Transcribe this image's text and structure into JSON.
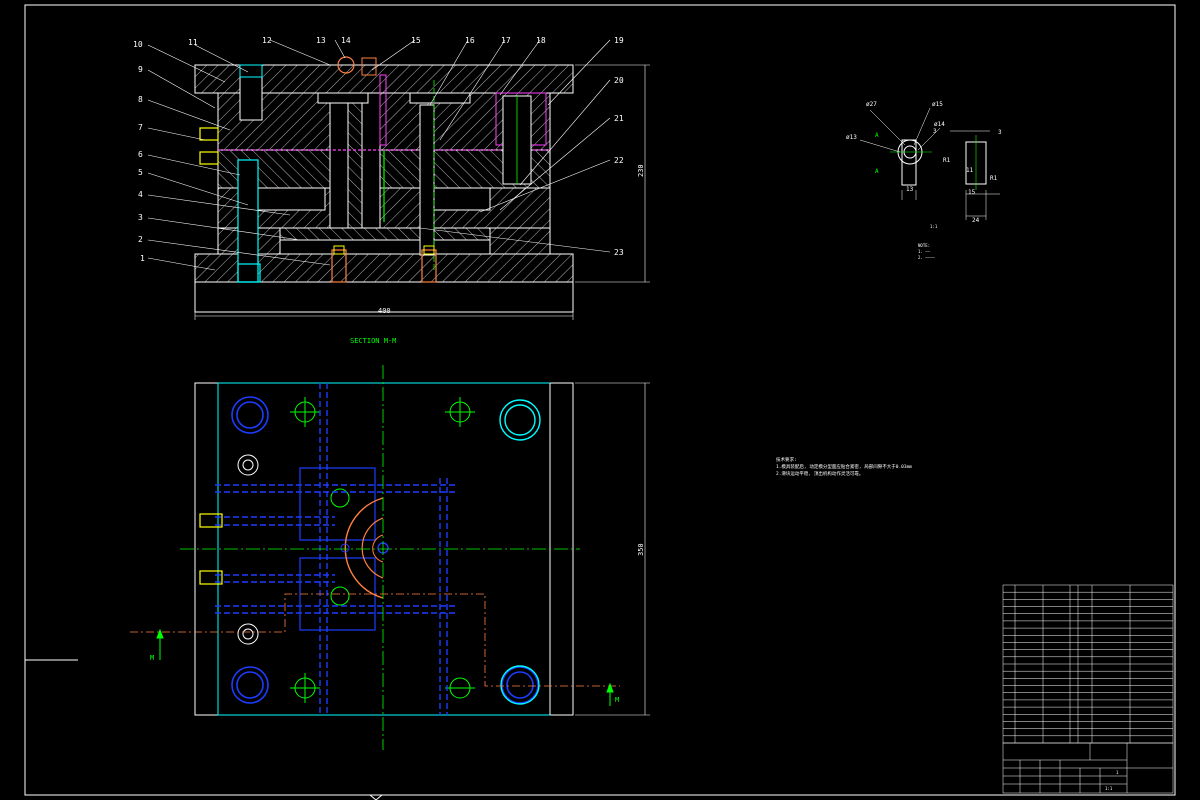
{
  "drawing": {
    "section_title": "SECTION M-M",
    "section_mark": "M",
    "balloons": [
      "1",
      "2",
      "3",
      "4",
      "5",
      "6",
      "7",
      "8",
      "9",
      "10",
      "11",
      "12",
      "13",
      "14",
      "15",
      "16",
      "17",
      "18",
      "19",
      "20",
      "21",
      "22",
      "23"
    ],
    "dims": {
      "width_top": "400",
      "height_side": "230",
      "height_plan": "350"
    },
    "detail": {
      "labels": [
        "ø27",
        "ø15",
        "ø13",
        "ø14",
        "A",
        "A",
        "3",
        "R1",
        "R1",
        "13",
        "15",
        "3",
        "11",
        "24"
      ],
      "caption": "1:1",
      "notes": [
        "NOTE:",
        "1. ——",
        "2. ————"
      ]
    },
    "tech_req": [
      "技术要求:",
      "1.模具装配后, 动定模分型面应贴合紧密, 局部间隙不大于0.03mm",
      "2.滑块运动平稳, 顶出机构动作灵活可靠。"
    ],
    "bom_rows": 22,
    "title_block": {
      "scale": "1:1",
      "sheet": "1"
    }
  },
  "colors": {
    "bg": "#000000",
    "outline": "#ffffff",
    "hatch": "#ffffff",
    "cyan": "#00ffff",
    "blue": "#1e3cff",
    "green": "#00ff00",
    "yellow": "#ffff00",
    "magenta": "#ff40ff",
    "orange": "#ff8040"
  }
}
